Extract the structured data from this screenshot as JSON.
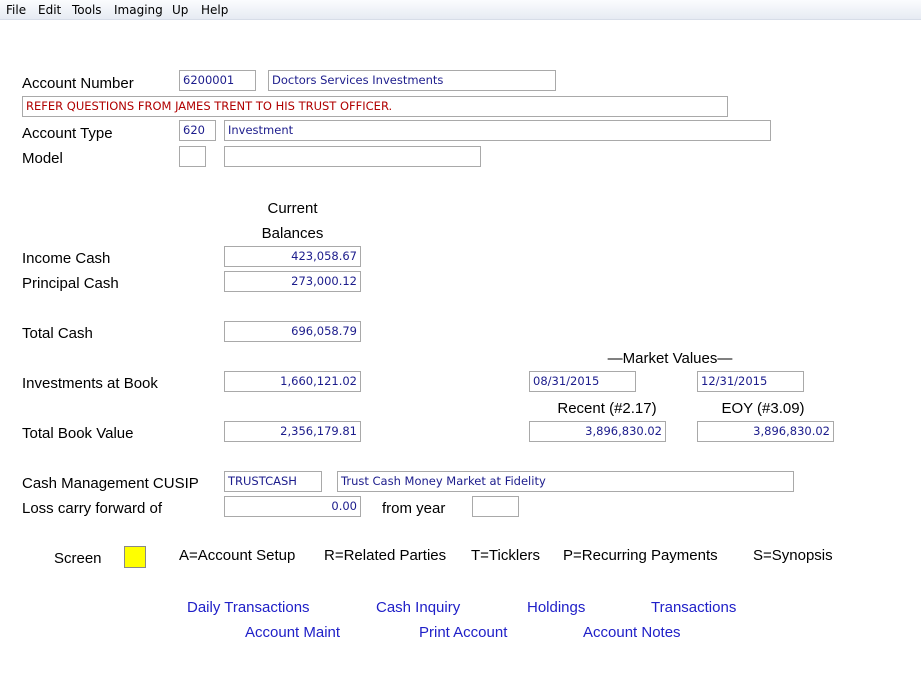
{
  "menu": [
    "File",
    "Edit",
    "Tools",
    "Imaging",
    "Up",
    "Help"
  ],
  "account": {
    "number_label": "Account Number",
    "number": "6200001",
    "name": "Doctors Services Investments",
    "notice": "REFER QUESTIONS FROM JAMES TRENT TO HIS TRUST OFFICER.",
    "type_label": "Account Type",
    "type_code": "620",
    "type_name": "Investment",
    "model_label": "Model",
    "model_code": "",
    "model_name": ""
  },
  "balances": {
    "header_line1": "Current",
    "header_line2": "Balances",
    "income_cash_label": "Income Cash",
    "income_cash": "423,058.67",
    "principal_cash_label": "Principal Cash",
    "principal_cash": "273,000.12",
    "total_cash_label": "Total Cash",
    "total_cash": "696,058.79",
    "investments_label": "Investments at Book",
    "investments": "1,660,121.02",
    "total_book_label": "Total Book Value",
    "total_book": "2,356,179.81"
  },
  "market_values": {
    "header": "—Market Values—",
    "recent_date": "08/31/2015",
    "eoy_date": "12/31/2015",
    "recent_label": "Recent (#2.17)",
    "eoy_label": "EOY (#3.09)",
    "recent_value": "3,896,830.02",
    "eoy_value": "3,896,830.02"
  },
  "cash_mgmt": {
    "cusip_label": "Cash Management CUSIP",
    "cusip": "TRUSTCASH",
    "cusip_name": "Trust Cash Money Market at Fidelity",
    "loss_label": "Loss carry forward of",
    "loss_value": "0.00",
    "from_year_label": "from year",
    "from_year": ""
  },
  "screen": {
    "label": "Screen",
    "value": "",
    "options": [
      "A=Account Setup",
      "R=Related Parties",
      "T=Ticklers",
      "P=Recurring Payments",
      "S=Synopsis"
    ]
  },
  "links": {
    "daily_transactions": "Daily Transactions",
    "cash_inquiry": "Cash Inquiry",
    "holdings": "Holdings",
    "transactions": "Transactions",
    "account_maint": "Account Maint",
    "print_account": "Print Account",
    "account_notes": "Account Notes"
  },
  "colors": {
    "field_text": "#1c1c8c",
    "warning_text": "#b00000",
    "link": "#2020c8",
    "screen_field": "#ffff00"
  }
}
